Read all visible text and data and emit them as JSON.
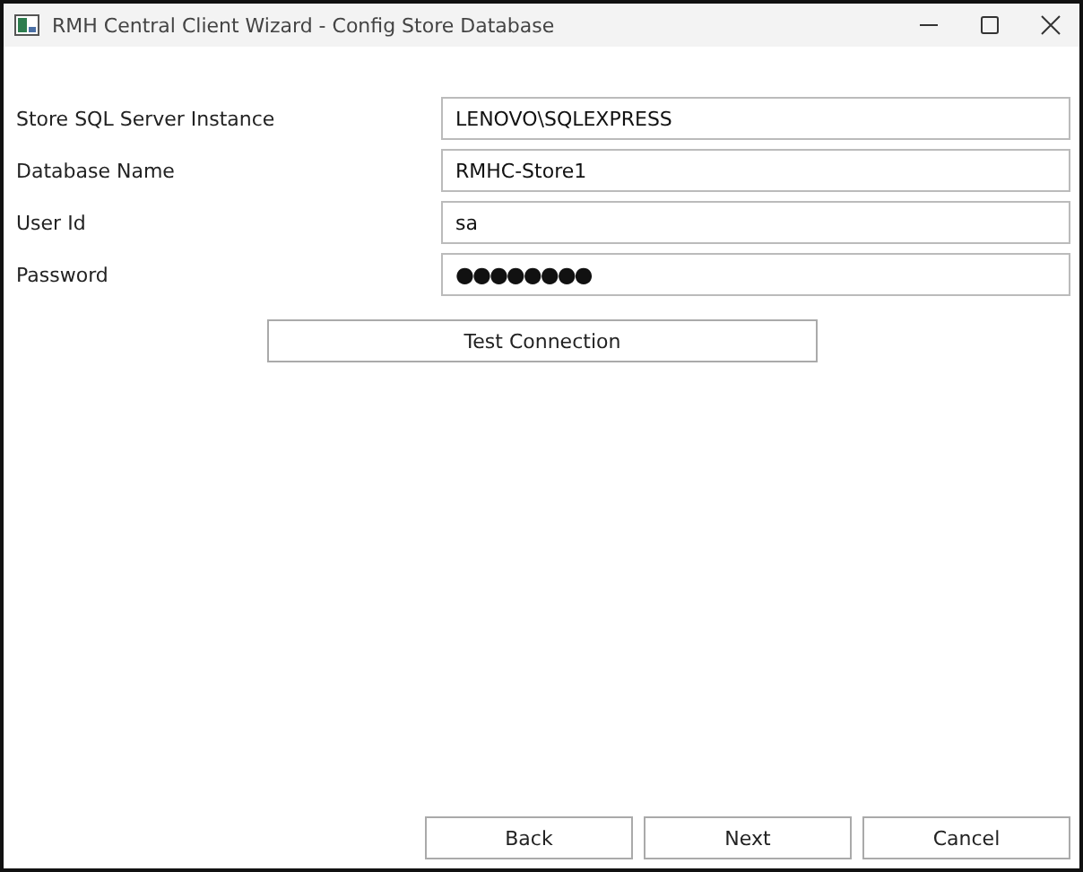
{
  "window": {
    "title": "RMH Central Client Wizard - Config Store Database"
  },
  "fields": [
    {
      "label": "Store SQL Server Instance",
      "value": "LENOVO\\SQLEXPRESS",
      "kind": "text"
    },
    {
      "label": "Database Name",
      "value": "RMHC-Store1",
      "kind": "text"
    },
    {
      "label": "User Id",
      "value": "sa",
      "kind": "text"
    },
    {
      "label": "Password",
      "value": "●●●●●●●●",
      "kind": "password"
    }
  ],
  "test_button": "Test Connection",
  "buttons": [
    "Back",
    "Next",
    "Cancel"
  ]
}
